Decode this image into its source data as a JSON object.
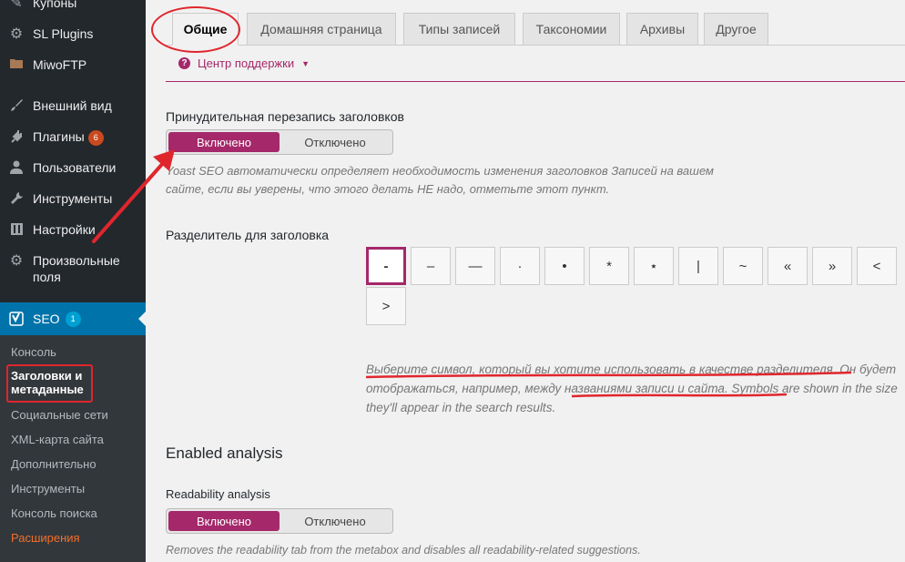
{
  "sidebar": {
    "items": [
      {
        "icon": "tag-icon",
        "label": "Купоны"
      },
      {
        "icon": "gear-icon",
        "label": "SL Plugins"
      },
      {
        "icon": "folder-icon",
        "label": "MiwoFTP"
      },
      {
        "icon": "brush-icon",
        "label": "Внешний вид"
      },
      {
        "icon": "plug-icon",
        "label": "Плагины",
        "badge": "6"
      },
      {
        "icon": "user-icon",
        "label": "Пользователи"
      },
      {
        "icon": "wrench-icon",
        "label": "Инструменты"
      },
      {
        "icon": "settings-icon",
        "label": "Настройки"
      },
      {
        "icon": "gear-icon",
        "label": "Произвольные поля"
      }
    ],
    "seo": {
      "icon": "yoast-icon",
      "label": "SEO",
      "badge": "1"
    },
    "submenu": [
      "Консоль",
      "Заголовки и метаданные",
      "Социальные сети",
      "XML-карта сайта",
      "Дополнительно",
      "Инструменты",
      "Консоль поиска",
      "Расширения"
    ]
  },
  "tabs": [
    "Общие",
    "Домашняя страница",
    "Типы записей",
    "Таксономии",
    "Архивы",
    "Другое"
  ],
  "help": {
    "icon": "question-icon",
    "label": "Центр поддержки"
  },
  "force_rewrite": {
    "label": "Принудительная перезапись заголовков",
    "on": "Включено",
    "off": "Отключено",
    "description": "Yoast SEO автоматически определяет необходимость изменения заголовков Записей на вашем сайте, если вы уверены, что этого делать НЕ надо, отметьте этот пункт."
  },
  "separator": {
    "label": "Разделитель для заголовка",
    "options": [
      "-",
      "–",
      "—",
      "·",
      "•",
      "*",
      "⋆",
      "|",
      "~",
      "«",
      "»",
      "<",
      ">"
    ],
    "selected_index": 0,
    "desc_part1": "Выберите символ, который вы хотите использовать в качестве разделителя",
    "desc_part2": ". Он будет отображаться, например, ",
    "desc_part3": "между названиями записи и сайта",
    "desc_part4": ". Symbols are shown in the size they'll appear in the search results."
  },
  "analysis": {
    "heading": "Enabled analysis",
    "readability_label": "Readability analysis",
    "on": "Включено",
    "off": "Отключено",
    "readability_desc": "Removes the readability tab from the metabox and disables all readability-related suggestions."
  },
  "colors": {
    "yoast_purple": "#a4286a",
    "wp_blue": "#0073aa",
    "annotation_red": "#e0262d"
  }
}
